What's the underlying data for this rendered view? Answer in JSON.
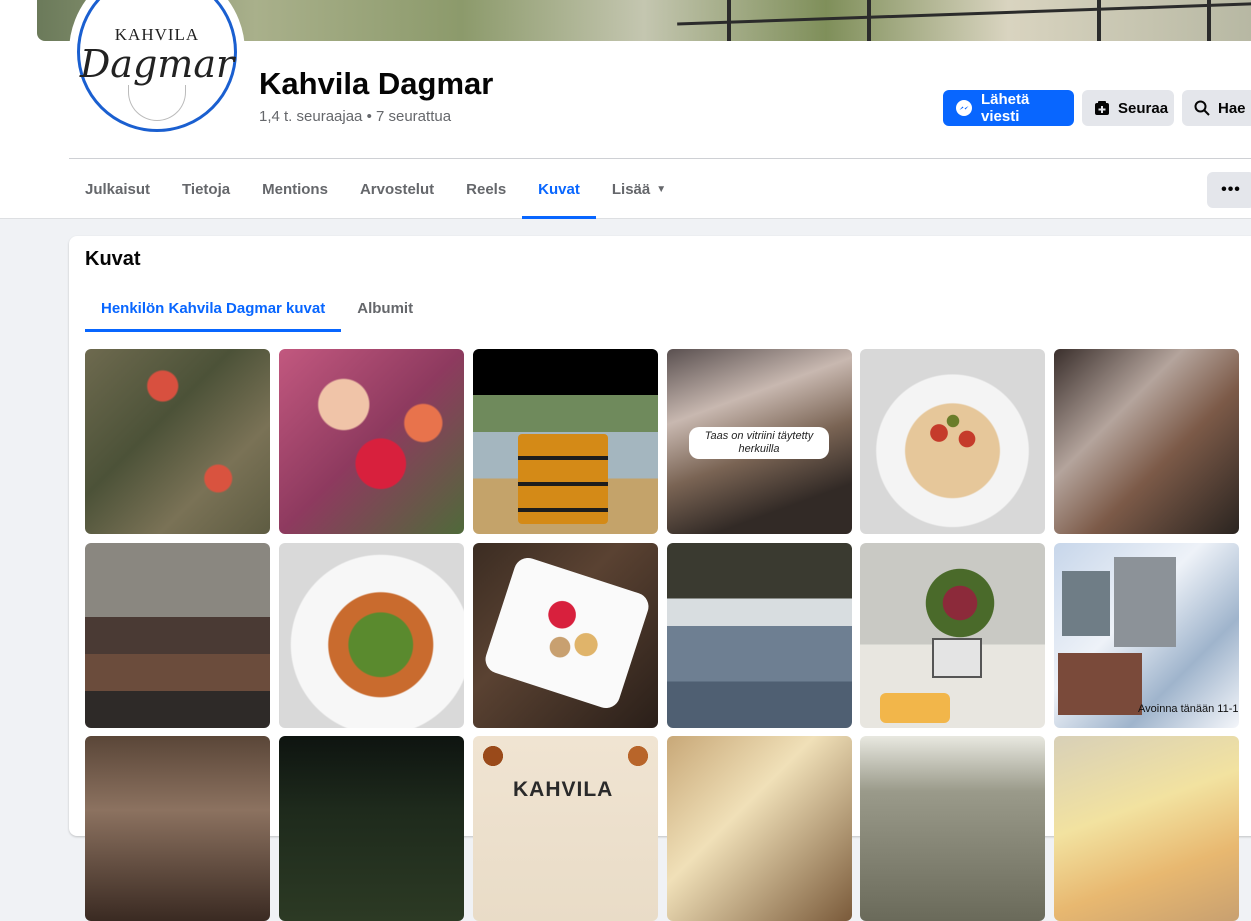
{
  "page": {
    "name": "Kahvila Dagmar",
    "stats": "1,4 t. seuraajaa • 7 seurattua",
    "logo": {
      "top": "KAHVILA",
      "main": "Dagmar"
    }
  },
  "actions": {
    "message": "Lähetä viesti",
    "follow": "Seuraa",
    "search": "Hae"
  },
  "tabs": [
    {
      "label": "Julkaisut",
      "active": false
    },
    {
      "label": "Tietoja",
      "active": false
    },
    {
      "label": "Mentions",
      "active": false
    },
    {
      "label": "Arvostelut",
      "active": false
    },
    {
      "label": "Reels",
      "active": false
    },
    {
      "label": "Kuvat",
      "active": true
    },
    {
      "label": "Lisää",
      "active": false
    }
  ],
  "photos_section": {
    "title": "Kuvat",
    "subtabs": [
      {
        "label": "Henkilön Kahvila Dagmar kuvat",
        "active": true
      },
      {
        "label": "Albumit",
        "active": false
      }
    ],
    "captions": {
      "vitriini": "Taas on vitriini täytetty herkuilla",
      "avoinna": "Avoinna tänään 11-1",
      "kahvila": "KAHVILA"
    }
  },
  "colors": {
    "accent": "#0866ff",
    "secondary_button": "#e4e6eb",
    "page_bg": "#f0f2f5"
  }
}
